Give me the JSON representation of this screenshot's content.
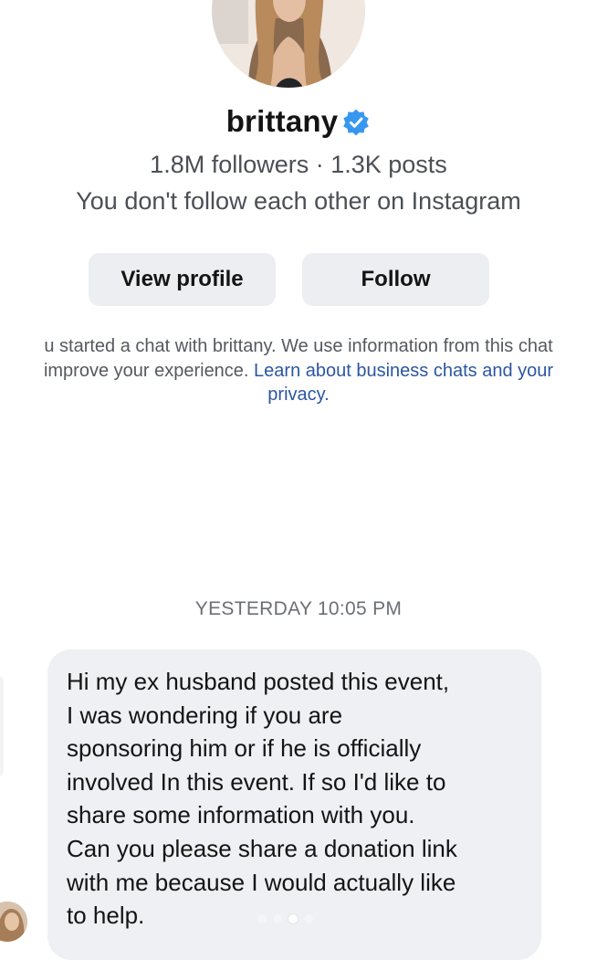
{
  "profile": {
    "name": "brittany",
    "verified": true,
    "stats": "1.8M followers · 1.3K posts",
    "relation": "You don't follow each other on Instagram",
    "avatar_icon": "profile-photo",
    "verified_icon": "verified-badge-icon",
    "verified_color": "#3797f0"
  },
  "actions": {
    "view_profile": "View profile",
    "follow": "Follow"
  },
  "notice": {
    "line1": "u started a chat with brittany. We use information from this chat",
    "line2_prefix": "improve your experience. ",
    "line2_link": "Learn about business chats and your",
    "line3_link": "privacy."
  },
  "conversation": {
    "timestamp": "YESTERDAY 10:05 PM",
    "message": "Hi my ex husband posted this event,\nI was wondering if you are\nsponsoring him or if he is officially\ninvolved In this event. If so I'd like to\nshare some information with you.\nCan you please share a donation link\nwith me because I would actually like\nto help."
  },
  "pagination": {
    "total": 4,
    "active_index": 3
  },
  "colors": {
    "link": "#2c56a2",
    "button_bg": "#eceef2",
    "bubble_bg": "#eef0f3"
  }
}
